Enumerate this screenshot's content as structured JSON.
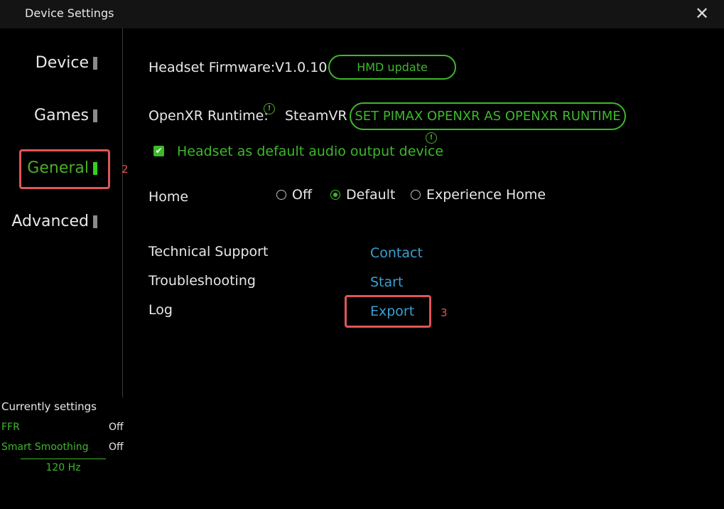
{
  "window": {
    "title": "Device Settings",
    "close_glyph": "✕"
  },
  "sidebar": {
    "items": [
      {
        "label": "Device"
      },
      {
        "label": "Games"
      },
      {
        "label": "General"
      },
      {
        "label": "Advanced"
      }
    ],
    "active": "General"
  },
  "annotations": {
    "general_num": "2",
    "export_num": "3"
  },
  "firmware": {
    "label": "Headset Firmware:",
    "version": "V1.0.10",
    "button": "HMD update"
  },
  "openxr": {
    "label": "OpenXR Runtime:",
    "value": "SteamVR",
    "button": "SET PIMAX OPENXR AS OPENXR RUNTIME",
    "info_glyph": "!"
  },
  "audio": {
    "label": "Headset as default audio output device",
    "checked": true,
    "check_glyph": "✔"
  },
  "home": {
    "label": "Home",
    "options": [
      "Off",
      "Default",
      "Experience Home"
    ],
    "selected": "Default"
  },
  "support": {
    "technical_label": "Technical Support",
    "technical_link": "Contact",
    "troubleshooting_label": "Troubleshooting",
    "troubleshooting_link": "Start",
    "log_label": "Log",
    "log_link": "Export"
  },
  "status": {
    "title": "Currently settings",
    "ffr_label": "FFR",
    "ffr_value": "Off",
    "smoothing_label": "Smart Smoothing",
    "smoothing_value": "Off",
    "refresh": "120 Hz"
  },
  "colors": {
    "accent_green": "#3db82a",
    "link_blue": "#3a9fd0",
    "annotation_red": "#e05656"
  }
}
